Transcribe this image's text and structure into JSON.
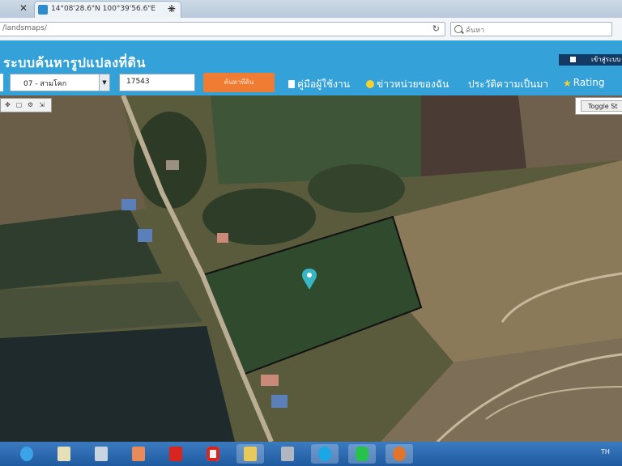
{
  "browser": {
    "tab_title": "14°08'28.6\"N 100°39'56.6\"E",
    "new_tab": "+",
    "url": "/landsmaps/",
    "search_placeholder": "ค้นหา"
  },
  "app": {
    "title": "ระบบค้นหารูปแปลงที่ดิน",
    "login_label": "เข้าสู่ระบบ | R",
    "district_select": "07 - สามโคก",
    "parcel_number": "17543",
    "search_button": "ค้นหาที่ดิน",
    "menu": [
      {
        "label": "คู่มือผู้ใช้งาน",
        "icon": "manual-icon"
      },
      {
        "label": "ข่าวหน่วยของฉัน",
        "icon": "smiley-icon"
      },
      {
        "label": "ประวัติความเป็นมา",
        "icon": "none"
      },
      {
        "label": "Rating",
        "icon": "star-icon"
      }
    ]
  },
  "map": {
    "toggle_label": "Toggle St",
    "tools": [
      "pan-icon",
      "square-icon",
      "gear-icon",
      "share-icon"
    ]
  },
  "taskbar": {
    "items": [
      "ie-icon",
      "file-manager-icon",
      "calculator-icon",
      "photos-icon",
      "pdf-icon",
      "acrobat-icon",
      "folder-icon",
      "printer-icon",
      "skype-icon",
      "line-icon",
      "firefox-icon"
    ],
    "time": "TH"
  }
}
